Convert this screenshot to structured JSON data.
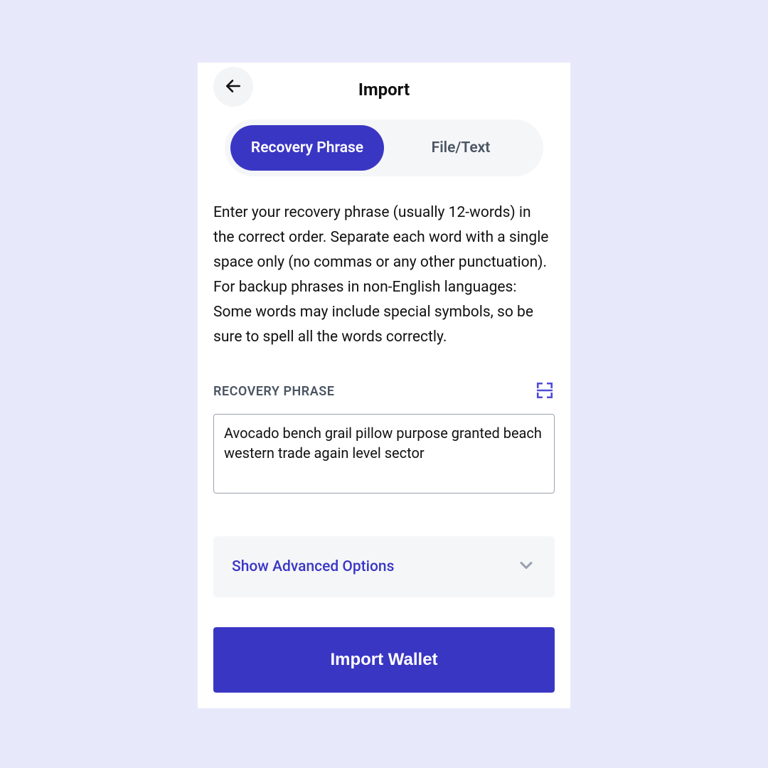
{
  "header": {
    "title": "Import"
  },
  "tabs": {
    "recovery": "Recovery Phrase",
    "file": "File/Text",
    "active": "recovery"
  },
  "instructions": "Enter your recovery phrase (usually 12-words) in the correct order. Separate each word with a single space only (no commas or any other punctuation). For backup phrases in non-English languages: Some words may include special symbols, so be sure to spell all the words correctly.",
  "field": {
    "label": "RECOVERY PHRASE",
    "value": "Avocado bench grail pillow purpose granted beach western trade again level sector"
  },
  "advanced": {
    "label": "Show Advanced Options"
  },
  "import_button": "Import Wallet",
  "colors": {
    "accent": "#3a36c4",
    "page_bg": "#e7e9fb",
    "tab_bg": "#f5f6f8",
    "muted_text": "#4b5563"
  }
}
